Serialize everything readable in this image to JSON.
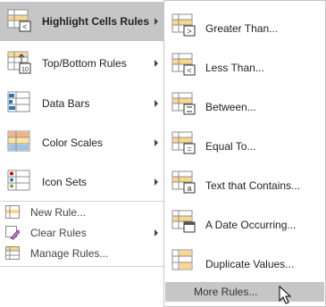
{
  "main_menu": {
    "items": [
      {
        "label": "Highlight Cells Rules",
        "icon": "highlight-cells-rules-icon"
      },
      {
        "label": "Top/Bottom Rules",
        "icon": "top-bottom-rules-icon"
      },
      {
        "label": "Data Bars",
        "icon": "data-bars-icon"
      },
      {
        "label": "Color Scales",
        "icon": "color-scales-icon"
      },
      {
        "label": "Icon Sets",
        "icon": "icon-sets-icon"
      }
    ],
    "small_items": [
      {
        "label": "New Rule...",
        "icon": "new-rule-icon"
      },
      {
        "label": "Clear Rules",
        "icon": "clear-rules-icon"
      },
      {
        "label": "Manage Rules...",
        "icon": "manage-rules-icon"
      }
    ]
  },
  "sub_menu": {
    "items": [
      {
        "label": "Greater Than...",
        "icon": "greater-than-icon"
      },
      {
        "label": "Less Than...",
        "icon": "less-than-icon"
      },
      {
        "label": "Between...",
        "icon": "between-icon"
      },
      {
        "label": "Equal To...",
        "icon": "equal-to-icon"
      },
      {
        "label": "Text that Contains...",
        "icon": "text-contains-icon"
      },
      {
        "label": "A Date Occurring...",
        "icon": "date-occurring-icon"
      },
      {
        "label": "Duplicate Values...",
        "icon": "duplicate-values-icon"
      }
    ],
    "more_rules": "More Rules..."
  },
  "colors": {
    "highlight": "#c6c6c6",
    "cell_fill": "#fbd78c",
    "grid": "#8c8c8c"
  }
}
